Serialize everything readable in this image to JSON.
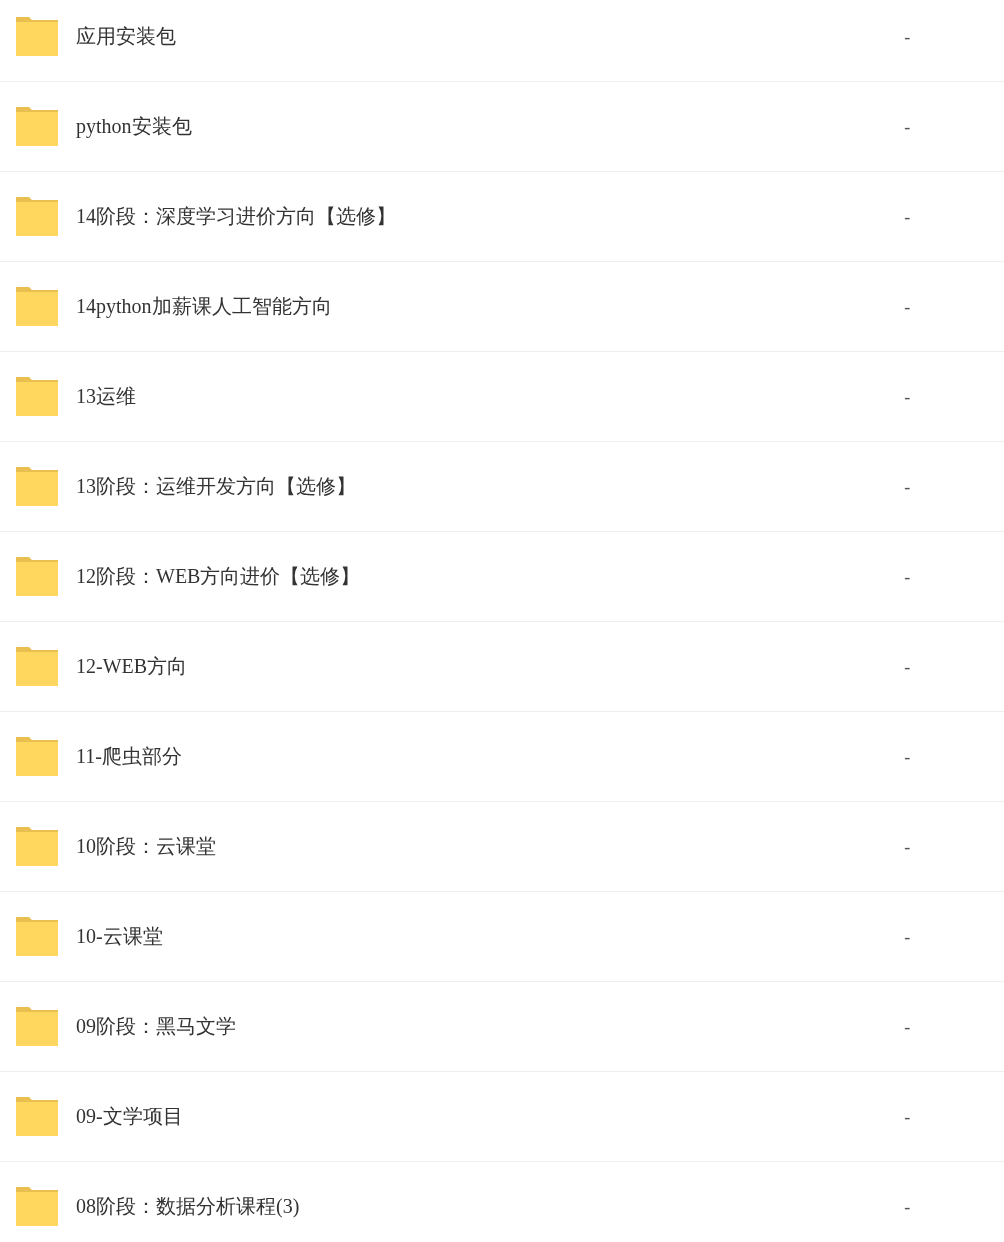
{
  "files": [
    {
      "name": "应用安装包",
      "size": "-"
    },
    {
      "name": "python安装包",
      "size": "-"
    },
    {
      "name": "14阶段：深度学习进价方向【选修】",
      "size": "-"
    },
    {
      "name": "14python加薪课人工智能方向",
      "size": "-"
    },
    {
      "name": "13运维",
      "size": "-"
    },
    {
      "name": "13阶段：运维开发方向【选修】",
      "size": "-"
    },
    {
      "name": "12阶段：WEB方向进价【选修】",
      "size": "-"
    },
    {
      "name": "12-WEB方向",
      "size": "-"
    },
    {
      "name": "11-爬虫部分",
      "size": "-"
    },
    {
      "name": "10阶段：云课堂",
      "size": "-"
    },
    {
      "name": "10-云课堂",
      "size": "-"
    },
    {
      "name": "09阶段：黑马文学",
      "size": "-"
    },
    {
      "name": "09-文学项目",
      "size": "-"
    },
    {
      "name": "08阶段：数据分析课程(3)",
      "size": "-"
    }
  ]
}
